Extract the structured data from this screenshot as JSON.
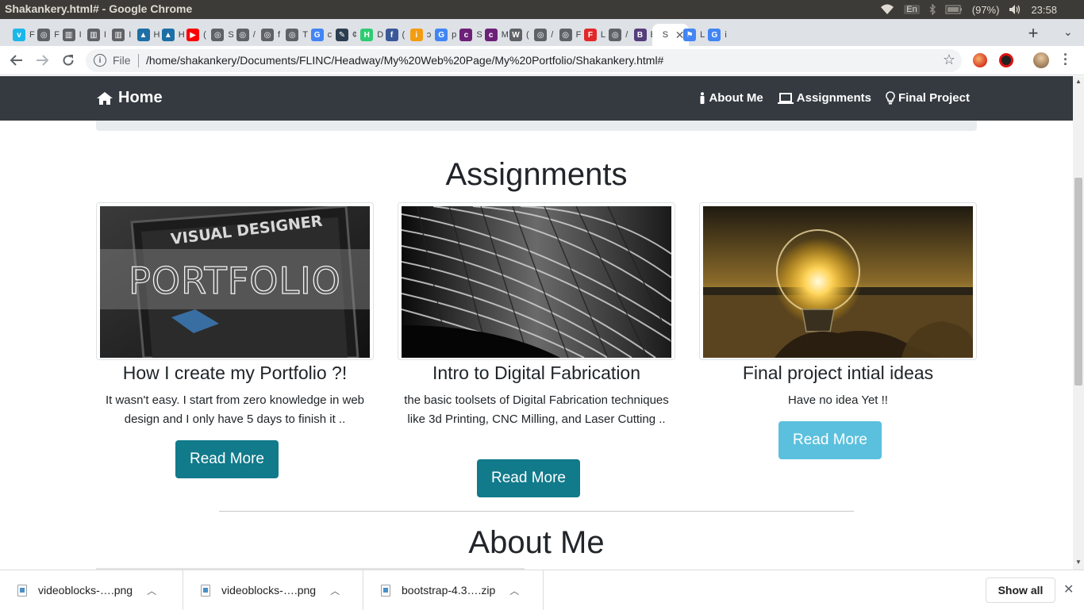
{
  "window": {
    "title": "Shakankery.html# - Google Chrome"
  },
  "system_tray": {
    "keyboard_layout": "En",
    "battery": "(97%)",
    "time": "23:58"
  },
  "tabs": [
    {
      "letter": "F",
      "favicon": "vimeo-icon",
      "color": "#1ab7ea",
      "glyph": "v"
    },
    {
      "letter": "F",
      "favicon": "globe-icon",
      "color": "#5f6368",
      "glyph": "◎"
    },
    {
      "letter": "I",
      "favicon": "book-icon",
      "color": "#5f6368",
      "glyph": "▥"
    },
    {
      "letter": "I",
      "favicon": "book-icon",
      "color": "#5f6368",
      "glyph": "▥"
    },
    {
      "letter": "I",
      "favicon": "book-icon",
      "color": "#5f6368",
      "glyph": "▥"
    },
    {
      "letter": "H",
      "favicon": "bird-icon",
      "color": "#1d6fa5",
      "glyph": "▲"
    },
    {
      "letter": "H",
      "favicon": "bird-icon",
      "color": "#1d6fa5",
      "glyph": "▲"
    },
    {
      "letter": "(",
      "favicon": "youtube-icon",
      "color": "#ff0000",
      "glyph": "▶"
    },
    {
      "letter": "S",
      "favicon": "globe-icon",
      "color": "#5f6368",
      "glyph": "◎"
    },
    {
      "letter": "/",
      "favicon": "globe-icon",
      "color": "#5f6368",
      "glyph": "◎"
    },
    {
      "letter": "f",
      "favicon": "globe-icon",
      "color": "#5f6368",
      "glyph": "◎"
    },
    {
      "letter": "T",
      "favicon": "globe-icon",
      "color": "#5f6368",
      "glyph": "◎"
    },
    {
      "letter": "c",
      "favicon": "google-icon",
      "color": "#4285f4",
      "glyph": "G"
    },
    {
      "letter": "¢",
      "favicon": "pen-icon",
      "color": "#2c3e50",
      "glyph": "✎"
    },
    {
      "letter": "D",
      "favicon": "h-icon",
      "color": "#2ecc71",
      "glyph": "H"
    },
    {
      "letter": "(",
      "favicon": "facebook-icon",
      "color": "#3b5998",
      "glyph": "f"
    },
    {
      "letter": "ɔ",
      "favicon": "info-icon",
      "color": "#f39c12",
      "glyph": "i"
    },
    {
      "letter": "p",
      "favicon": "google-icon",
      "color": "#4285f4",
      "glyph": "G"
    },
    {
      "letter": "S",
      "favicon": "colorlib-icon",
      "color": "#6d2077",
      "glyph": "c"
    },
    {
      "letter": "M",
      "favicon": "colorlib-icon",
      "color": "#6d2077",
      "glyph": "c"
    },
    {
      "letter": "(",
      "favicon": "wordpress-icon",
      "color": "#5f6368",
      "glyph": "W"
    },
    {
      "letter": "/",
      "favicon": "globe-icon",
      "color": "#5f6368",
      "glyph": "◎"
    },
    {
      "letter": "F",
      "favicon": "globe-icon",
      "color": "#5f6368",
      "glyph": "◎"
    },
    {
      "letter": "L",
      "favicon": "flipboard-icon",
      "color": "#e12828",
      "glyph": "F"
    },
    {
      "letter": "/",
      "favicon": "globe-icon",
      "color": "#5f6368",
      "glyph": "◎"
    },
    {
      "letter": "E",
      "favicon": "bootstrap-icon",
      "color": "#563d7c",
      "glyph": "B"
    },
    {
      "letter": "S",
      "favicon": "close-icon",
      "color": "#5f6368",
      "glyph": "",
      "active": true
    },
    {
      "letter": "L",
      "favicon": "flag-icon",
      "color": "#4285f4",
      "glyph": "⚑"
    },
    {
      "letter": "i",
      "favicon": "google-icon",
      "color": "#4285f4",
      "glyph": "G"
    }
  ],
  "toolbar": {
    "info_label": "File",
    "url": "/home/shakankery/Documents/FLINC/Headway/My%20Web%20Page/My%20Portfolio/Shakankery.html#"
  },
  "page": {
    "navbar": {
      "brand": "Home",
      "links": [
        {
          "label": "About Me",
          "icon": "person-icon"
        },
        {
          "label": "Assignments",
          "icon": "laptop-icon"
        },
        {
          "label": "Final Project",
          "icon": "lightbulb-icon"
        }
      ]
    },
    "assignments_heading": "Assignments",
    "cards": [
      {
        "title": "How I create my Portfolio ?!",
        "text": "It wasn't easy. I start from zero knowledge in web design and I only have 5 days to finish it ..",
        "button": "Read More",
        "button_color": "#117a8b",
        "image_text_1": "VISUAL DESIGNER",
        "image_text_2": "PORTFOLIO"
      },
      {
        "title": "Intro to Digital Fabrication",
        "text": "the basic toolsets of Digital Fabrication techniques like 3d Printing, CNC Milling, and Laser Cutting ..",
        "button": "Read More",
        "button_color": "#117a8b"
      },
      {
        "title": "Final project intial ideas",
        "text": "Have no idea Yet !!",
        "button": "Read More",
        "button_color": "#5bc0de"
      }
    ],
    "about_heading": "About Me"
  },
  "downloads": [
    {
      "name": "videoblocks-….png"
    },
    {
      "name": "videoblocks-….png"
    },
    {
      "name": "bootstrap-4.3….zip"
    }
  ],
  "download_bar": {
    "show_all": "Show all"
  },
  "colors": {
    "navbar": "#343a40",
    "accent_dark": "#117a8b",
    "accent_light": "#5bc0de"
  }
}
